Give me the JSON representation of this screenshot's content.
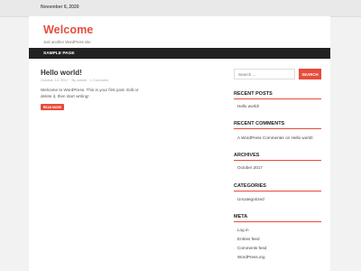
{
  "topbar": {
    "date": "November 6, 2020"
  },
  "site": {
    "title": "Welcome",
    "description": "Just another WordPress site"
  },
  "nav": {
    "items": [
      {
        "label": "SAMPLE PAGE"
      }
    ]
  },
  "post": {
    "title": "Hello world!",
    "meta": "October 13, 2017 · By admin · 1 Comment",
    "excerpt": "Welcome to WordPress. This is your first post. Edit or delete it, then start writing!",
    "read_more_label": "READ MORE"
  },
  "search": {
    "placeholder": "Search ...",
    "button_label": "SEARCH"
  },
  "widgets": {
    "recent_posts": {
      "title": "RECENT POSTS",
      "items": [
        "Hello world!"
      ]
    },
    "recent_comments": {
      "title": "RECENT COMMENTS",
      "items": [
        "A WordPress Commenter on Hello world!"
      ]
    },
    "archives": {
      "title": "ARCHIVES",
      "items": [
        "October 2017"
      ]
    },
    "categories": {
      "title": "CATEGORIES",
      "items": [
        "Uncategorized"
      ]
    },
    "meta": {
      "title": "META",
      "items": [
        "Log in",
        "Entries feed",
        "Comments feed",
        "WordPress.org"
      ]
    }
  },
  "colors": {
    "accent": "#e74c3c",
    "navbar": "#222222",
    "background": "#f2f2f2"
  }
}
